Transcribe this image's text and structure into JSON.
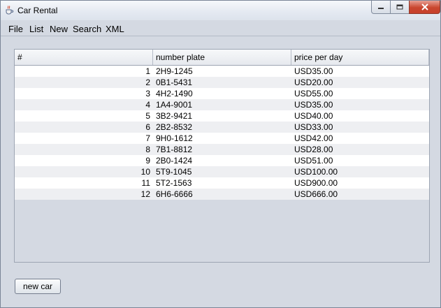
{
  "window": {
    "title": "Car Rental"
  },
  "menu": [
    "File",
    "List",
    "New",
    "Search",
    "XML"
  ],
  "table": {
    "columns": [
      "#",
      "number plate",
      "price per day"
    ],
    "rows": [
      [
        "1",
        "2H9-1245",
        "USD35.00"
      ],
      [
        "2",
        "0B1-5431",
        "USD20.00"
      ],
      [
        "3",
        "4H2-1490",
        "USD55.00"
      ],
      [
        "4",
        "1A4-9001",
        "USD35.00"
      ],
      [
        "5",
        "3B2-9421",
        "USD40.00"
      ],
      [
        "6",
        "2B2-8532",
        "USD33.00"
      ],
      [
        "7",
        "9H0-1612",
        "USD42.00"
      ],
      [
        "8",
        "7B1-8812",
        "USD28.00"
      ],
      [
        "9",
        "2B0-1424",
        "USD51.00"
      ],
      [
        "10",
        "5T9-1045",
        "USD100.00"
      ],
      [
        "11",
        "5T2-1563",
        "USD900.00"
      ],
      [
        "12",
        "6H6-6666",
        "USD666.00"
      ]
    ]
  },
  "buttons": {
    "new_car": "new car"
  },
  "icons": {
    "app": "java-cup-icon",
    "minimize": "minimize-icon",
    "maximize": "maximize-icon",
    "close": "close-icon"
  }
}
